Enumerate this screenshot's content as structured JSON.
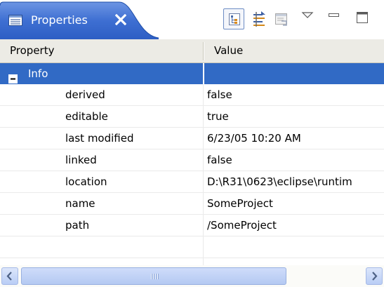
{
  "view": {
    "tab_title": "Properties",
    "tab_icon": "properties-icon",
    "close_icon": "close-icon",
    "toolbar": [
      {
        "name": "show-categories-button",
        "icon": "categories-icon",
        "selected": true
      },
      {
        "name": "show-advanced-properties-button",
        "icon": "advanced-properties-icon",
        "selected": false
      },
      {
        "name": "restore-default-value-button",
        "icon": "restore-default-icon",
        "selected": false
      },
      {
        "name": "view-menu-button",
        "icon": "chevron-down-icon",
        "selected": false
      },
      {
        "name": "minimize-button",
        "icon": "minimize-icon",
        "selected": false
      },
      {
        "name": "maximize-button",
        "icon": "maximize-icon",
        "selected": false
      }
    ]
  },
  "table": {
    "columns": [
      "Property",
      "Value"
    ],
    "category": {
      "label": "Info",
      "toggle": "collapse-icon"
    },
    "rows": [
      {
        "property": "derived",
        "value": "false"
      },
      {
        "property": "editable",
        "value": "true"
      },
      {
        "property": "last modified",
        "value": "6/23/05 10:20 AM"
      },
      {
        "property": "linked",
        "value": "false"
      },
      {
        "property": "location",
        "value": "D:\\R31\\0623\\eclipse\\runtim"
      },
      {
        "property": "name",
        "value": "SomeProject"
      },
      {
        "property": "path",
        "value": "/SomeProject"
      }
    ]
  },
  "colors": {
    "tab_active": "#3a6bd0",
    "selection": "#316ac5",
    "header_bg": "#ecebe5"
  }
}
